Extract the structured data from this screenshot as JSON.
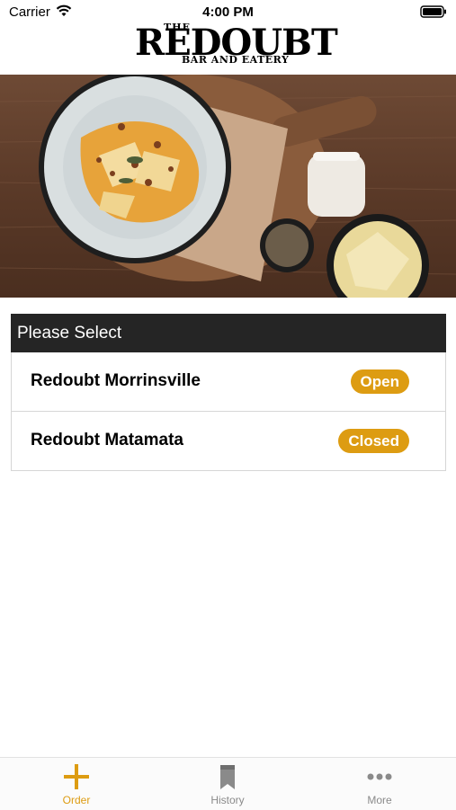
{
  "status_bar": {
    "carrier": "Carrier",
    "time": "4:00 PM"
  },
  "logo": {
    "the": "THE",
    "name": "REDOUBT",
    "tagline": "BAR AND EATERY"
  },
  "location_panel": {
    "header": "Please Select",
    "locations": [
      {
        "name": "Redoubt Morrinsville",
        "status": "Open"
      },
      {
        "name": "Redoubt Matamata",
        "status": "Closed"
      }
    ]
  },
  "tab_bar": {
    "tabs": [
      {
        "label": "Order",
        "icon": "plus-icon",
        "active": true
      },
      {
        "label": "History",
        "icon": "bookmark-icon",
        "active": false
      },
      {
        "label": "More",
        "icon": "ellipsis-icon",
        "active": false
      }
    ]
  },
  "colors": {
    "accent": "#dd9c12",
    "header_bg": "#252525"
  }
}
